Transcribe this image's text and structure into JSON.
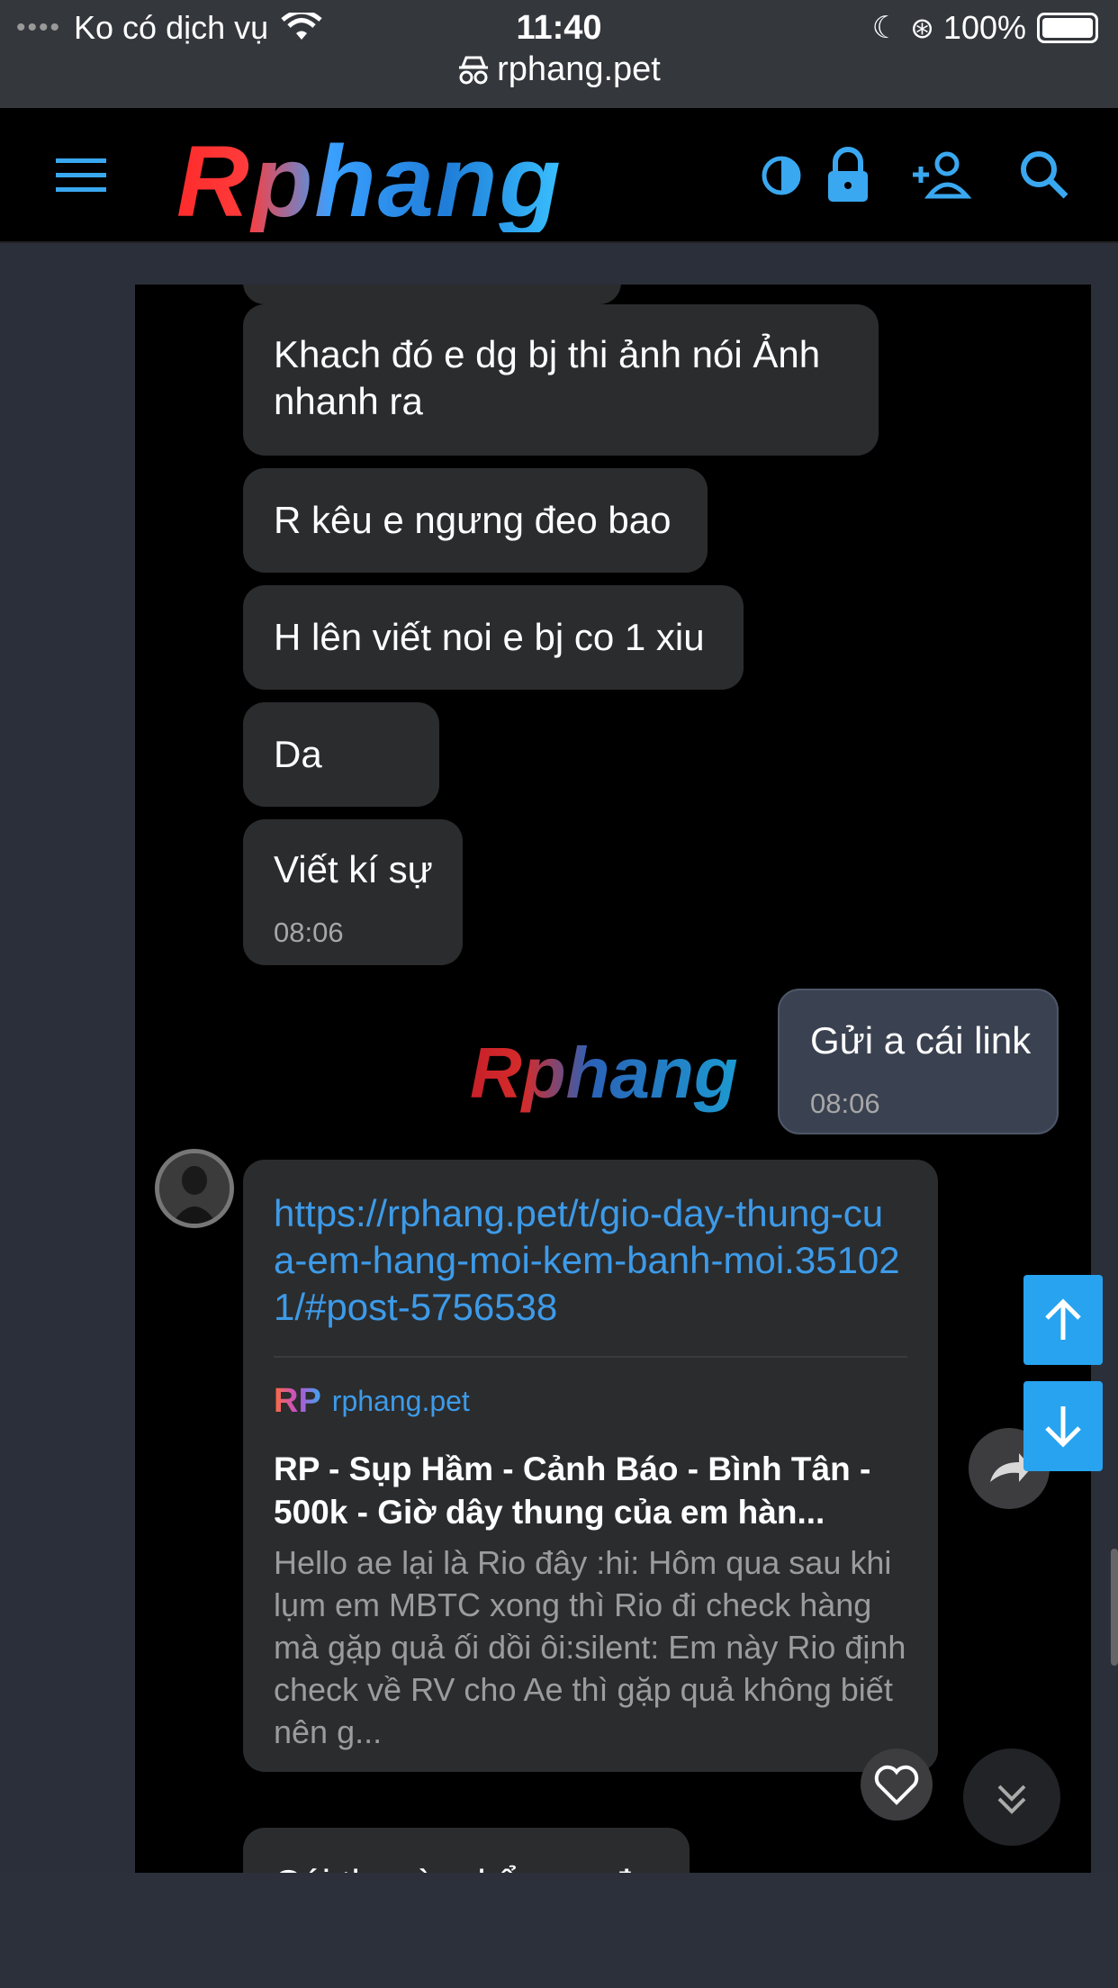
{
  "status_bar": {
    "carrier": "Ko có dịch vụ",
    "time": "11:40",
    "battery": "100%",
    "url": "rphang.pet"
  },
  "header": {
    "logo": "Rphang"
  },
  "messages": [
    {
      "text": "Khach đó e dg bj thi ảnh nói Ảnh nhanh ra"
    },
    {
      "text": "R kêu e ngưng đeo bao"
    },
    {
      "text": "H lên viết noi e bj co 1 xiu"
    },
    {
      "text": "Da"
    },
    {
      "text": "Viết kí sự",
      "time": "08:06"
    }
  ],
  "own_message": {
    "text": "Gửi a cái link",
    "time": "08:06",
    "logo": "Rphang"
  },
  "link_message": {
    "url": "https://rphang.pet/t/gio-day-thung-cua-em-hang-moi-kem-banh-moi.351021/#post-5756538",
    "preview": {
      "site_badge": "RP",
      "site": "rphang.pet",
      "title": "RP - Sụp Hầm - Cảnh Báo - Bình Tân - 500k - Giờ dây thung của em hàn...",
      "excerpt": "Hello ae lại là Rio đây :hi: Hôm qua sau khi lụm em MBTC xong thì Rio đi check hàng mà gặp quả ối dồi ôi:silent: Em này Rio định check về RV cho Ae thì gặp quả không biết nên g..."
    }
  },
  "partial_message": {
    "text": "Cái th mà e kể ya a đo"
  },
  "colors": {
    "accent": "#27a3f0",
    "link": "#3d9be9",
    "bubble": "#2b2c2e",
    "own_bubble": "#3a4150"
  }
}
